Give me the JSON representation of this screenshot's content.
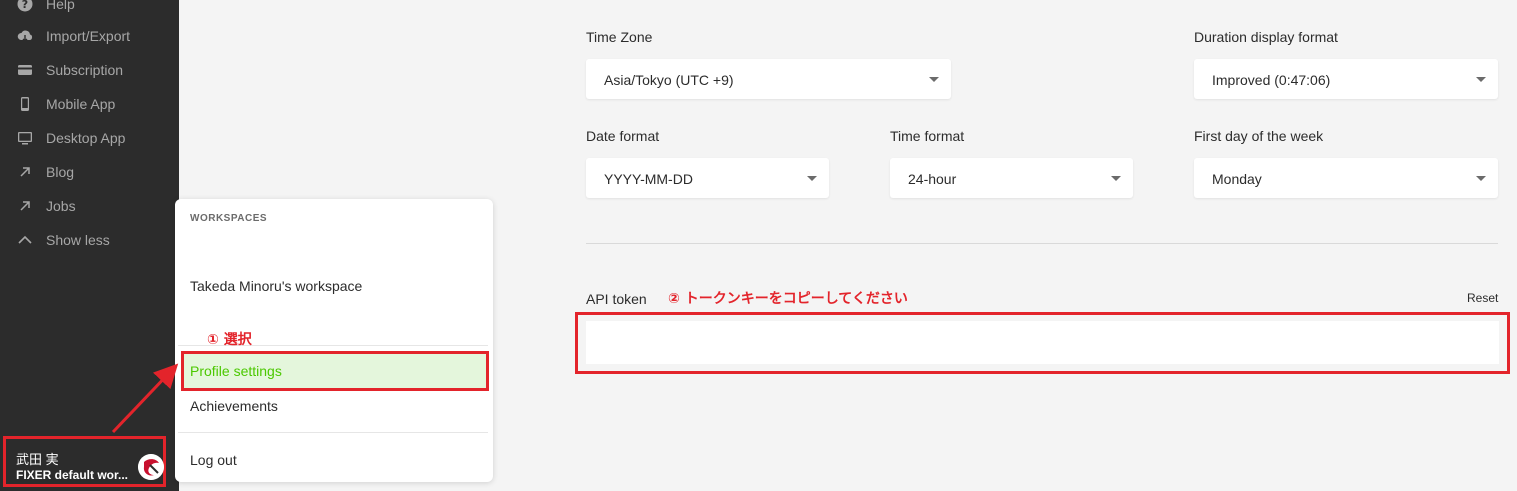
{
  "sidebar": {
    "items": [
      {
        "label": "Help",
        "icon": "help-icon"
      },
      {
        "label": "Import/Export",
        "icon": "cloud-icon"
      },
      {
        "label": "Subscription",
        "icon": "card-icon"
      },
      {
        "label": "Mobile App",
        "icon": "mobile-icon"
      },
      {
        "label": "Desktop App",
        "icon": "desktop-icon"
      },
      {
        "label": "Blog",
        "icon": "external-arrow-icon"
      },
      {
        "label": "Jobs",
        "icon": "external-arrow-icon"
      },
      {
        "label": "Show less",
        "icon": "chevron-up-icon"
      }
    ],
    "user": {
      "name": "武田 実",
      "workspace": "FIXER default wor..."
    }
  },
  "menu": {
    "heading": "WORKSPACES",
    "workspace": "Takeda Minoru's workspace",
    "profile_settings": "Profile settings",
    "achievements": "Achievements",
    "logout": "Log out"
  },
  "annotations": {
    "select": "① 選択",
    "copy_token": "② トークンキーをコピーしてください"
  },
  "settings": {
    "timezone": {
      "label": "Time Zone",
      "value": "Asia/Tokyo (UTC +9)"
    },
    "duration": {
      "label": "Duration display format",
      "value": "Improved (0:47:06)"
    },
    "date_format": {
      "label": "Date format",
      "value": "YYYY-MM-DD"
    },
    "time_format": {
      "label": "Time format",
      "value": "24-hour"
    },
    "first_day": {
      "label": "First day of the week",
      "value": "Monday"
    },
    "api_token": {
      "label": "API token",
      "reset": "Reset",
      "value": ""
    }
  },
  "colors": {
    "sidebar_bg": "#2c2c2c",
    "annotation_red": "#e3242b",
    "accent_green": "#4bc800",
    "page_bg": "#f4f4f4"
  }
}
